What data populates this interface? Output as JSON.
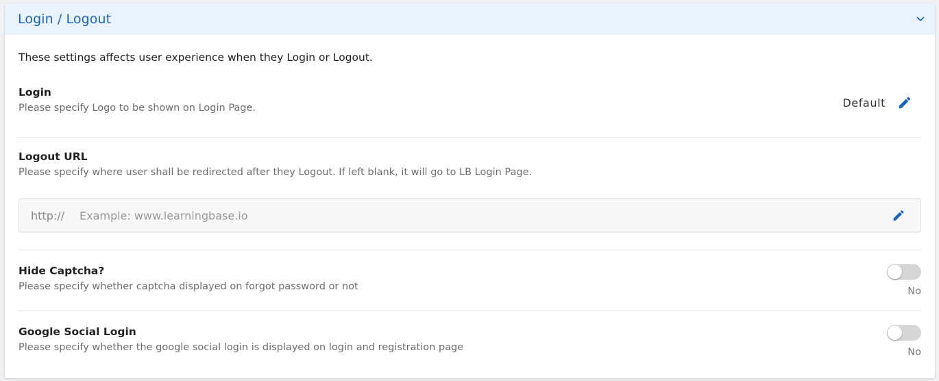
{
  "header": {
    "title": "Login / Logout"
  },
  "intro": "These settings affects user experience when they Login or Logout.",
  "login": {
    "title": "Login",
    "description": "Please specify Logo to be shown on Login Page.",
    "value": "Default"
  },
  "logout": {
    "title": "Logout URL",
    "description": "Please specify where user shall be redirected after they Logout. If left blank, it will go to LB Login Page.",
    "prefix": "http://",
    "placeholder": "Example: www.learningbase.io",
    "value": ""
  },
  "captcha": {
    "title": "Hide Captcha?",
    "description": "Please specify whether captcha displayed on forgot password or not",
    "value": "No"
  },
  "google": {
    "title": "Google Social Login",
    "description": "Please specify whether the google social login is displayed on login and registration page",
    "value": "No"
  },
  "colors": {
    "accent": "#1565c0",
    "header_bg": "#eaf3fd",
    "toggle_off": "#d6d6d6"
  },
  "icons": {
    "collapse": "chevron-down-icon",
    "edit": "pencil-icon"
  }
}
